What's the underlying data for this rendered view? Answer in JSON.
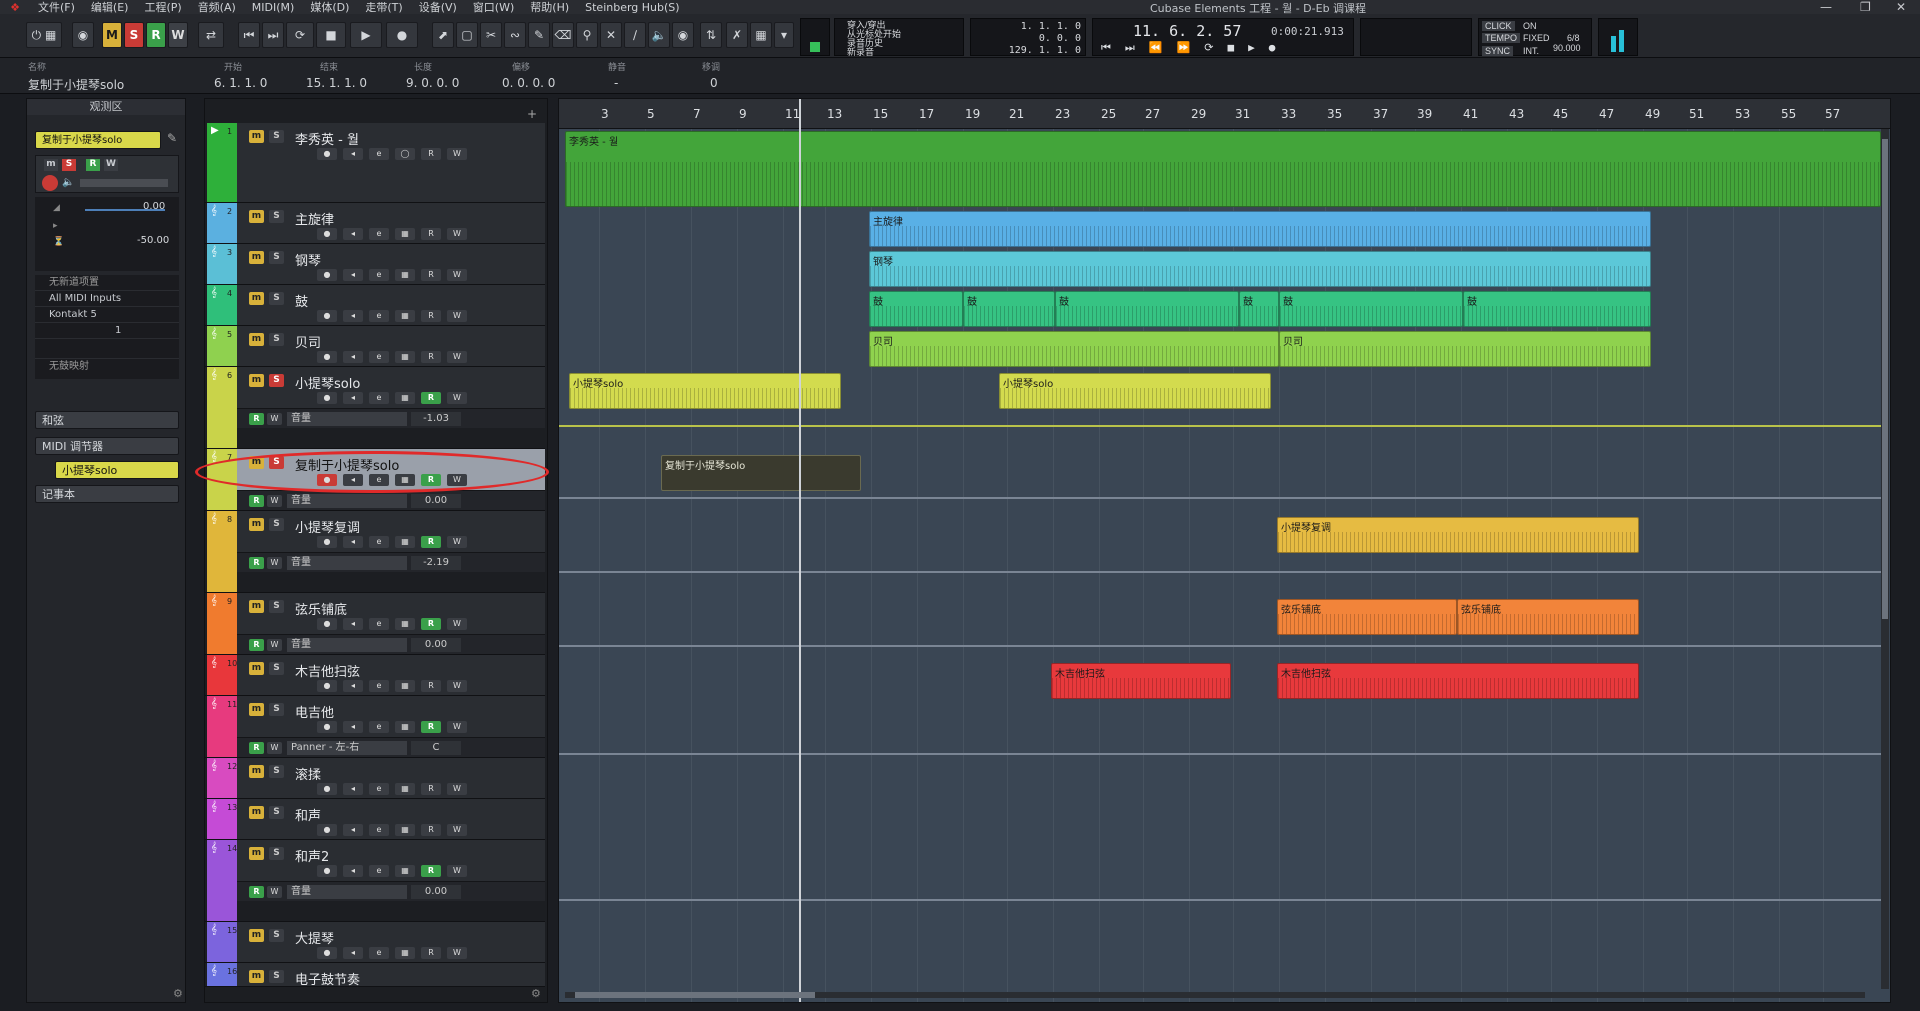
{
  "menu": {
    "items": [
      "文件(F)",
      "编辑(E)",
      "工程(P)",
      "音频(A)",
      "MIDI(M)",
      "媒体(D)",
      "走带(T)",
      "设备(V)",
      "窗口(W)",
      "帮助(H)",
      "Steinberg Hub(S)"
    ],
    "window_title": "Cubase Elements 工程 - 월 - D-Eb 调课程"
  },
  "toolbar": {
    "mute_btn": "M",
    "solo_btn": "S",
    "read_btn": "R",
    "write_btn": "W",
    "punch_in": "穿入/穿出",
    "cycle_start": "从光标处开始",
    "record_history": "录音历史",
    "new_take": "新录音",
    "pos_left": "1. 1. 1. 0",
    "pos_right": "129. 1. 1. 0",
    "pos_small": "0. 0. 0",
    "main_time": "11. 6. 2. 57",
    "time_sec": "0:00:21.913",
    "click_label": "CLICK",
    "click_state": "ON",
    "tempo_label": "TEMPO",
    "tempo_mode": "FIXED",
    "signature": "6/8",
    "tempo_value": "90.000",
    "sync_label": "SYNC",
    "sync_state": "INT."
  },
  "infoline": {
    "headers": [
      "名称",
      "开始",
      "结束",
      "长度",
      "偏移",
      "静音",
      "移调"
    ],
    "values": [
      "复制于小提琴solo",
      "6. 1. 1. 0",
      "15. 1. 1. 0",
      "9. 0. 0. 0",
      "0. 0. 0. 0",
      "-",
      "0"
    ]
  },
  "inspector": {
    "title": "观测区",
    "track_name": "复制于小提琴solo",
    "vol_val": "0.00",
    "pan_val": "-50.00",
    "no_preset": "无新道项置",
    "midi_input": "All MIDI Inputs",
    "instrument": "Kontakt 5",
    "channel": "1",
    "no_drum_map": "无鼓映射",
    "sections": [
      "和弦",
      "MIDI 调节器",
      "小提琴solo",
      "记事本"
    ]
  },
  "tracks": [
    {
      "num": "1",
      "name": "李秀英 - 월",
      "color": "#2eb03a"
    },
    {
      "num": "2",
      "name": "主旋律",
      "color": "#5bb0e0"
    },
    {
      "num": "3",
      "name": "钢琴",
      "color": "#5bbfd6"
    },
    {
      "num": "4",
      "name": "鼓",
      "color": "#2fbf7a"
    },
    {
      "num": "5",
      "name": "贝司",
      "color": "#8fd14f"
    },
    {
      "num": "6",
      "name": "小提琴solo",
      "color": "#c9d34a"
    },
    {
      "num": "7",
      "name": "复制于小提琴solo",
      "color": "#c9d34a"
    },
    {
      "num": "8",
      "name": "小提琴复调",
      "color": "#e0b63a"
    },
    {
      "num": "9",
      "name": "弦乐铺底",
      "color": "#f07b2e"
    },
    {
      "num": "10",
      "name": "木吉他扫弦",
      "color": "#e8373b"
    },
    {
      "num": "11",
      "name": "电吉他",
      "color": "#e73a7e"
    },
    {
      "num": "12",
      "name": "滚揉",
      "color": "#d84bc0"
    },
    {
      "num": "13",
      "name": "和声",
      "color": "#c54bd6"
    },
    {
      "num": "14",
      "name": "和声2",
      "color": "#9a55d9"
    },
    {
      "num": "15",
      "name": "大提琴",
      "color": "#7c64dd"
    },
    {
      "num": "16",
      "name": "电子鼓节奏",
      "color": "#6a72e0"
    }
  ],
  "lanes": {
    "volume_label": "音量",
    "panner_label": "Panner - 左-右",
    "t6_vol": "-1.03",
    "t7_vol": "0.00",
    "t8_vol": "-2.19",
    "t9_vol": "0.00",
    "t11_pan": "C",
    "t14_vol": "0.00"
  },
  "ruler": [
    "3",
    "5",
    "7",
    "9",
    "11",
    "13",
    "15",
    "17",
    "19",
    "21",
    "23",
    "25",
    "27",
    "29",
    "31",
    "33",
    "35",
    "37",
    "39",
    "41",
    "43",
    "45",
    "47",
    "49",
    "51",
    "53",
    "55",
    "57"
  ],
  "events": {
    "e1": "李秀英 - 월",
    "e2": "主旋律",
    "e3": "钢琴",
    "e4a": "鼓",
    "e4b": "鼓",
    "e4c": "鼓",
    "e4d": "鼓",
    "e4e": "鼓",
    "e4f": "鼓",
    "e5a": "贝司",
    "e5b": "贝司",
    "e6a": "小提琴solo",
    "e6b": "小提琴solo",
    "e7": "复制于小提琴solo",
    "e8": "小提琴复调",
    "e9a": "弦乐铺底",
    "e9b": "弦乐铺底",
    "e10a": "木吉他扫弦",
    "e10b": "木吉他扫弦"
  },
  "colors": {
    "accent_yellow": "#d8b13a",
    "record_red": "#c93b36",
    "read_green": "#3aa04a",
    "annotation_red": "#e02a2a"
  }
}
